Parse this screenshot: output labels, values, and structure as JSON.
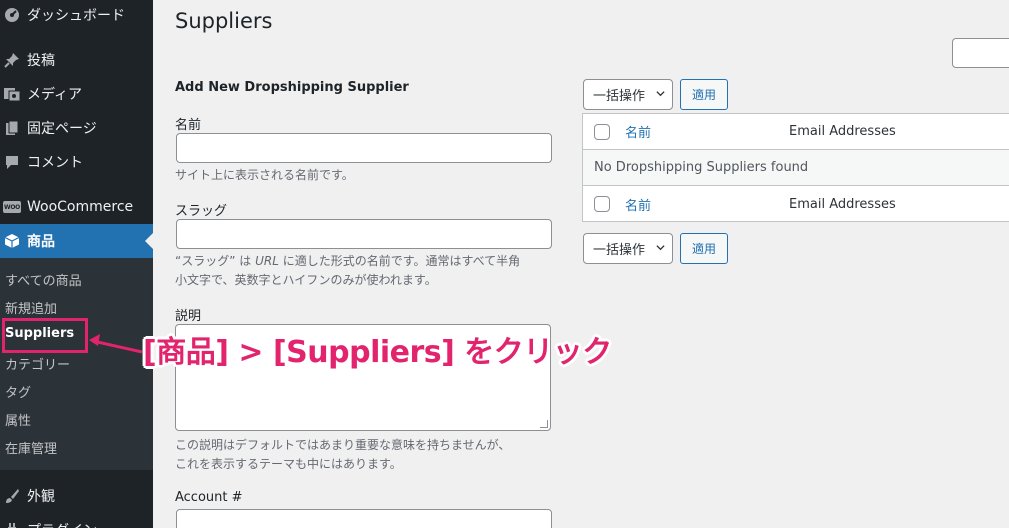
{
  "sidebar": {
    "items": [
      {
        "label": "ダッシュボード",
        "icon": "dashboard-icon"
      },
      {
        "label": "投稿",
        "icon": "pin-icon"
      },
      {
        "label": "メディア",
        "icon": "media-icon"
      },
      {
        "label": "固定ページ",
        "icon": "pages-icon"
      },
      {
        "label": "コメント",
        "icon": "comment-icon"
      },
      {
        "label": "WooCommerce",
        "icon": "woocommerce-icon",
        "logo_text": "WOO"
      },
      {
        "label": "商品",
        "icon": "products-icon"
      },
      {
        "label": "外観",
        "icon": "brush-icon"
      },
      {
        "label": "プラグイン",
        "icon": "plugin-icon"
      }
    ],
    "submenu": [
      "すべての商品",
      "新規追加",
      "Suppliers",
      "カテゴリー",
      "タグ",
      "属性",
      "在庫管理"
    ],
    "current_submenu": "Suppliers"
  },
  "page": {
    "title": "Suppliers"
  },
  "form": {
    "heading": "Add New Dropshipping Supplier",
    "name_label": "名前",
    "name_desc": "サイト上に表示される名前です。",
    "slug_label": "スラッグ",
    "slug_desc_1a": "“スラッグ” は ",
    "slug_desc_url": "URL",
    "slug_desc_1b": " に適した形式の名前です。通常はすべて半角",
    "slug_desc_2": "小文字で、英数字とハイフンのみが使われます。",
    "desc_label": "説明",
    "desc_desc_1": "この説明はデフォルトではあまり重要な意味を持ちませんが、",
    "desc_desc_2": "これを表示するテーマも中にはあります。",
    "account_label": "Account #"
  },
  "list": {
    "bulk_action": "一括操作",
    "apply": "適用",
    "col_name": "名前",
    "col_email": "Email Addresses",
    "empty": "No Dropshipping Suppliers found"
  },
  "annotation": {
    "text": "[商品] > [Suppliers] をクリック",
    "color": "#e2246e"
  },
  "colors": {
    "sidebar_bg": "#1d2327",
    "submenu_bg": "#2c3338",
    "accent": "#2271b1"
  }
}
